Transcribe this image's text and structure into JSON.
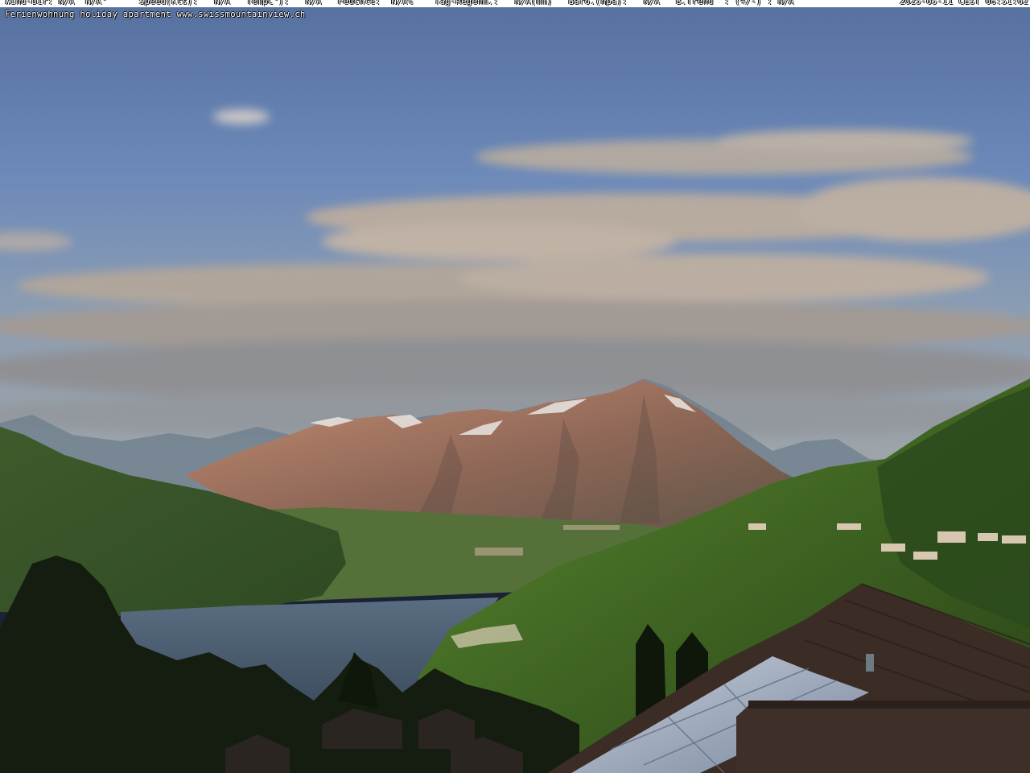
{
  "overlay": {
    "weather_line": "Wind-Dir: N/A  N/A°      Speed(Kts):   N/A   TempC°):   N/A   Feuchte:  N/A%    Tag-Regenm.:   N/A(mm)   Baro.(hpa):   N/A   B.Trend  : (+/-) : N/A",
    "timestamp": "2025-05-11 CEST 06:51:02",
    "site_line": "Ferienwohnung holiday apartment www.swissmountainview.ch"
  },
  "colors": {
    "sky_top": "#5b77a8",
    "sky_bottom": "#8aa0b8",
    "cloud": "#c9b8a6",
    "peak_lit": "#b07a62",
    "lake": "#4d5f73",
    "forest_dark": "#17220f",
    "slope_green": "#4f7a2a",
    "roof": "#3b2e28",
    "solar_panel": "#9aa8bc"
  },
  "icons": {
    "solar-panel": "solar-panel-icon"
  }
}
